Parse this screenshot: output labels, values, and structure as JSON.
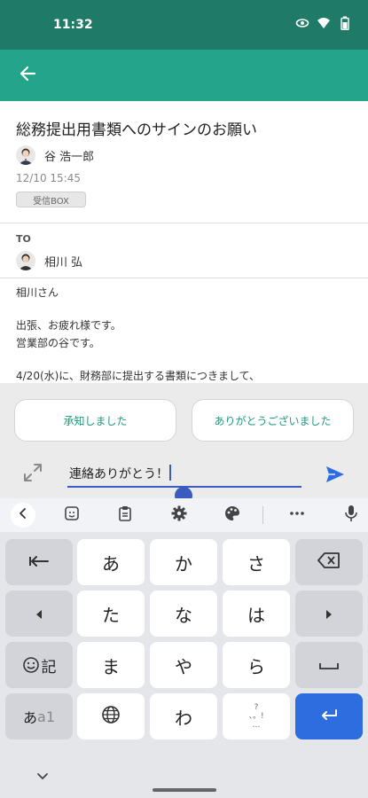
{
  "status_bar": {
    "time": "11:32"
  },
  "message": {
    "subject": "総務提出用書類へのサインのお願い",
    "sender": "谷 浩一郎",
    "date": "12/10 15:45",
    "folder": "受信BOX",
    "to_label": "TO",
    "recipient": "相川 弘",
    "body_lines": [
      "相川さん",
      "出張、お疲れ様です。",
      "営業部の谷です。",
      "4/20(水)に、財務部に提出する書類につきまして、"
    ]
  },
  "smart_replies": [
    "承知しました",
    "ありがとうございました"
  ],
  "reply_input": {
    "value": "連絡ありがとう！"
  },
  "keyboard": {
    "keys": {
      "a": "あ",
      "ka": "か",
      "sa": "さ",
      "ta": "た",
      "na": "な",
      "ha": "は",
      "ma": "ま",
      "ya": "や",
      "ra": "ら",
      "wa": "わ",
      "kigo": "記",
      "mode_kana": "あ",
      "mode_alpha": "a1",
      "punct_top": "?",
      "punct_mid": "、。!",
      "punct_bot": "…"
    }
  },
  "icons": {
    "back": "arrow-left-icon",
    "expand": "expand-icon",
    "send": "send-icon",
    "mic": "mic-icon",
    "settings": "gear-icon",
    "emoji": "smiley-icon",
    "globe": "globe-icon",
    "backspace": "backspace-icon"
  },
  "colors": {
    "status_bar": "#1f7a67",
    "app_bar": "#24a48a",
    "accent_text": "#1e9a7f",
    "input_underline": "#3a5bc0",
    "send": "#2d6de0",
    "enter_key": "#2d6de0"
  }
}
